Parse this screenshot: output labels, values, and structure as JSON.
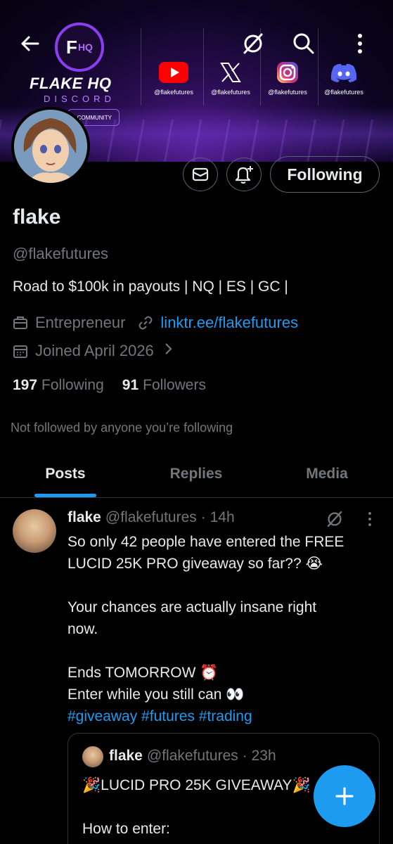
{
  "banner": {
    "brand_title": "FLAKE HQ",
    "brand_sub": "DISCORD",
    "community_label": "COMMUNITY",
    "logo_text": "F",
    "logo_hq": "HQ",
    "socials": [
      {
        "icon": "youtube-icon",
        "handle": "@flakefutures",
        "color": "#ff0000"
      },
      {
        "icon": "x-icon",
        "handle": "@flakefutures",
        "color": "#ffffff"
      },
      {
        "icon": "instagram-icon",
        "handle": "@flakefutures",
        "color": "#e1306c"
      },
      {
        "icon": "discord-icon",
        "handle": "@flakefutures",
        "color": "#5865f2"
      }
    ]
  },
  "nav": {
    "back_icon": "arrow-left-icon",
    "grok_icon": "grok-icon",
    "search_icon": "search-icon",
    "more_icon": "more-vertical-icon"
  },
  "profile": {
    "name": "flake",
    "handle": "@flakefutures",
    "bio": "Road to $100k in payouts | NQ | ES | GC |",
    "category": "Entrepreneur",
    "link": "linktr.ee/flakefutures",
    "joined": "Joined April 2026",
    "following_count": "197",
    "following_label": "Following",
    "followers_count": "91",
    "followers_label": "Followers",
    "not_followed": "Not followed by anyone you’re following",
    "follow_button": "Following"
  },
  "tabs": [
    {
      "label": "Posts",
      "active": true
    },
    {
      "label": "Replies",
      "active": false
    },
    {
      "label": "Media",
      "active": false
    }
  ],
  "post": {
    "name": "flake",
    "handle": "@flakefutures",
    "time": "· 14h",
    "line1": "So only 42 people have entered the FREE",
    "line2": "LUCID 25K PRO giveaway so far?? 😭",
    "line3": "Your chances are actually insane right",
    "line4": "now.",
    "line5": "Ends TOMORROW ⏰",
    "line6": "Enter while you still can 👀",
    "hashtags": "#giveaway #futures #trading",
    "quote": {
      "name": "flake",
      "handle": "@flakefutures",
      "time": "· 23h",
      "title": "🎉LUCID PRO 25K GIVEAWAY🎉",
      "line": "How to enter:"
    }
  },
  "fab": {
    "label": "+"
  }
}
